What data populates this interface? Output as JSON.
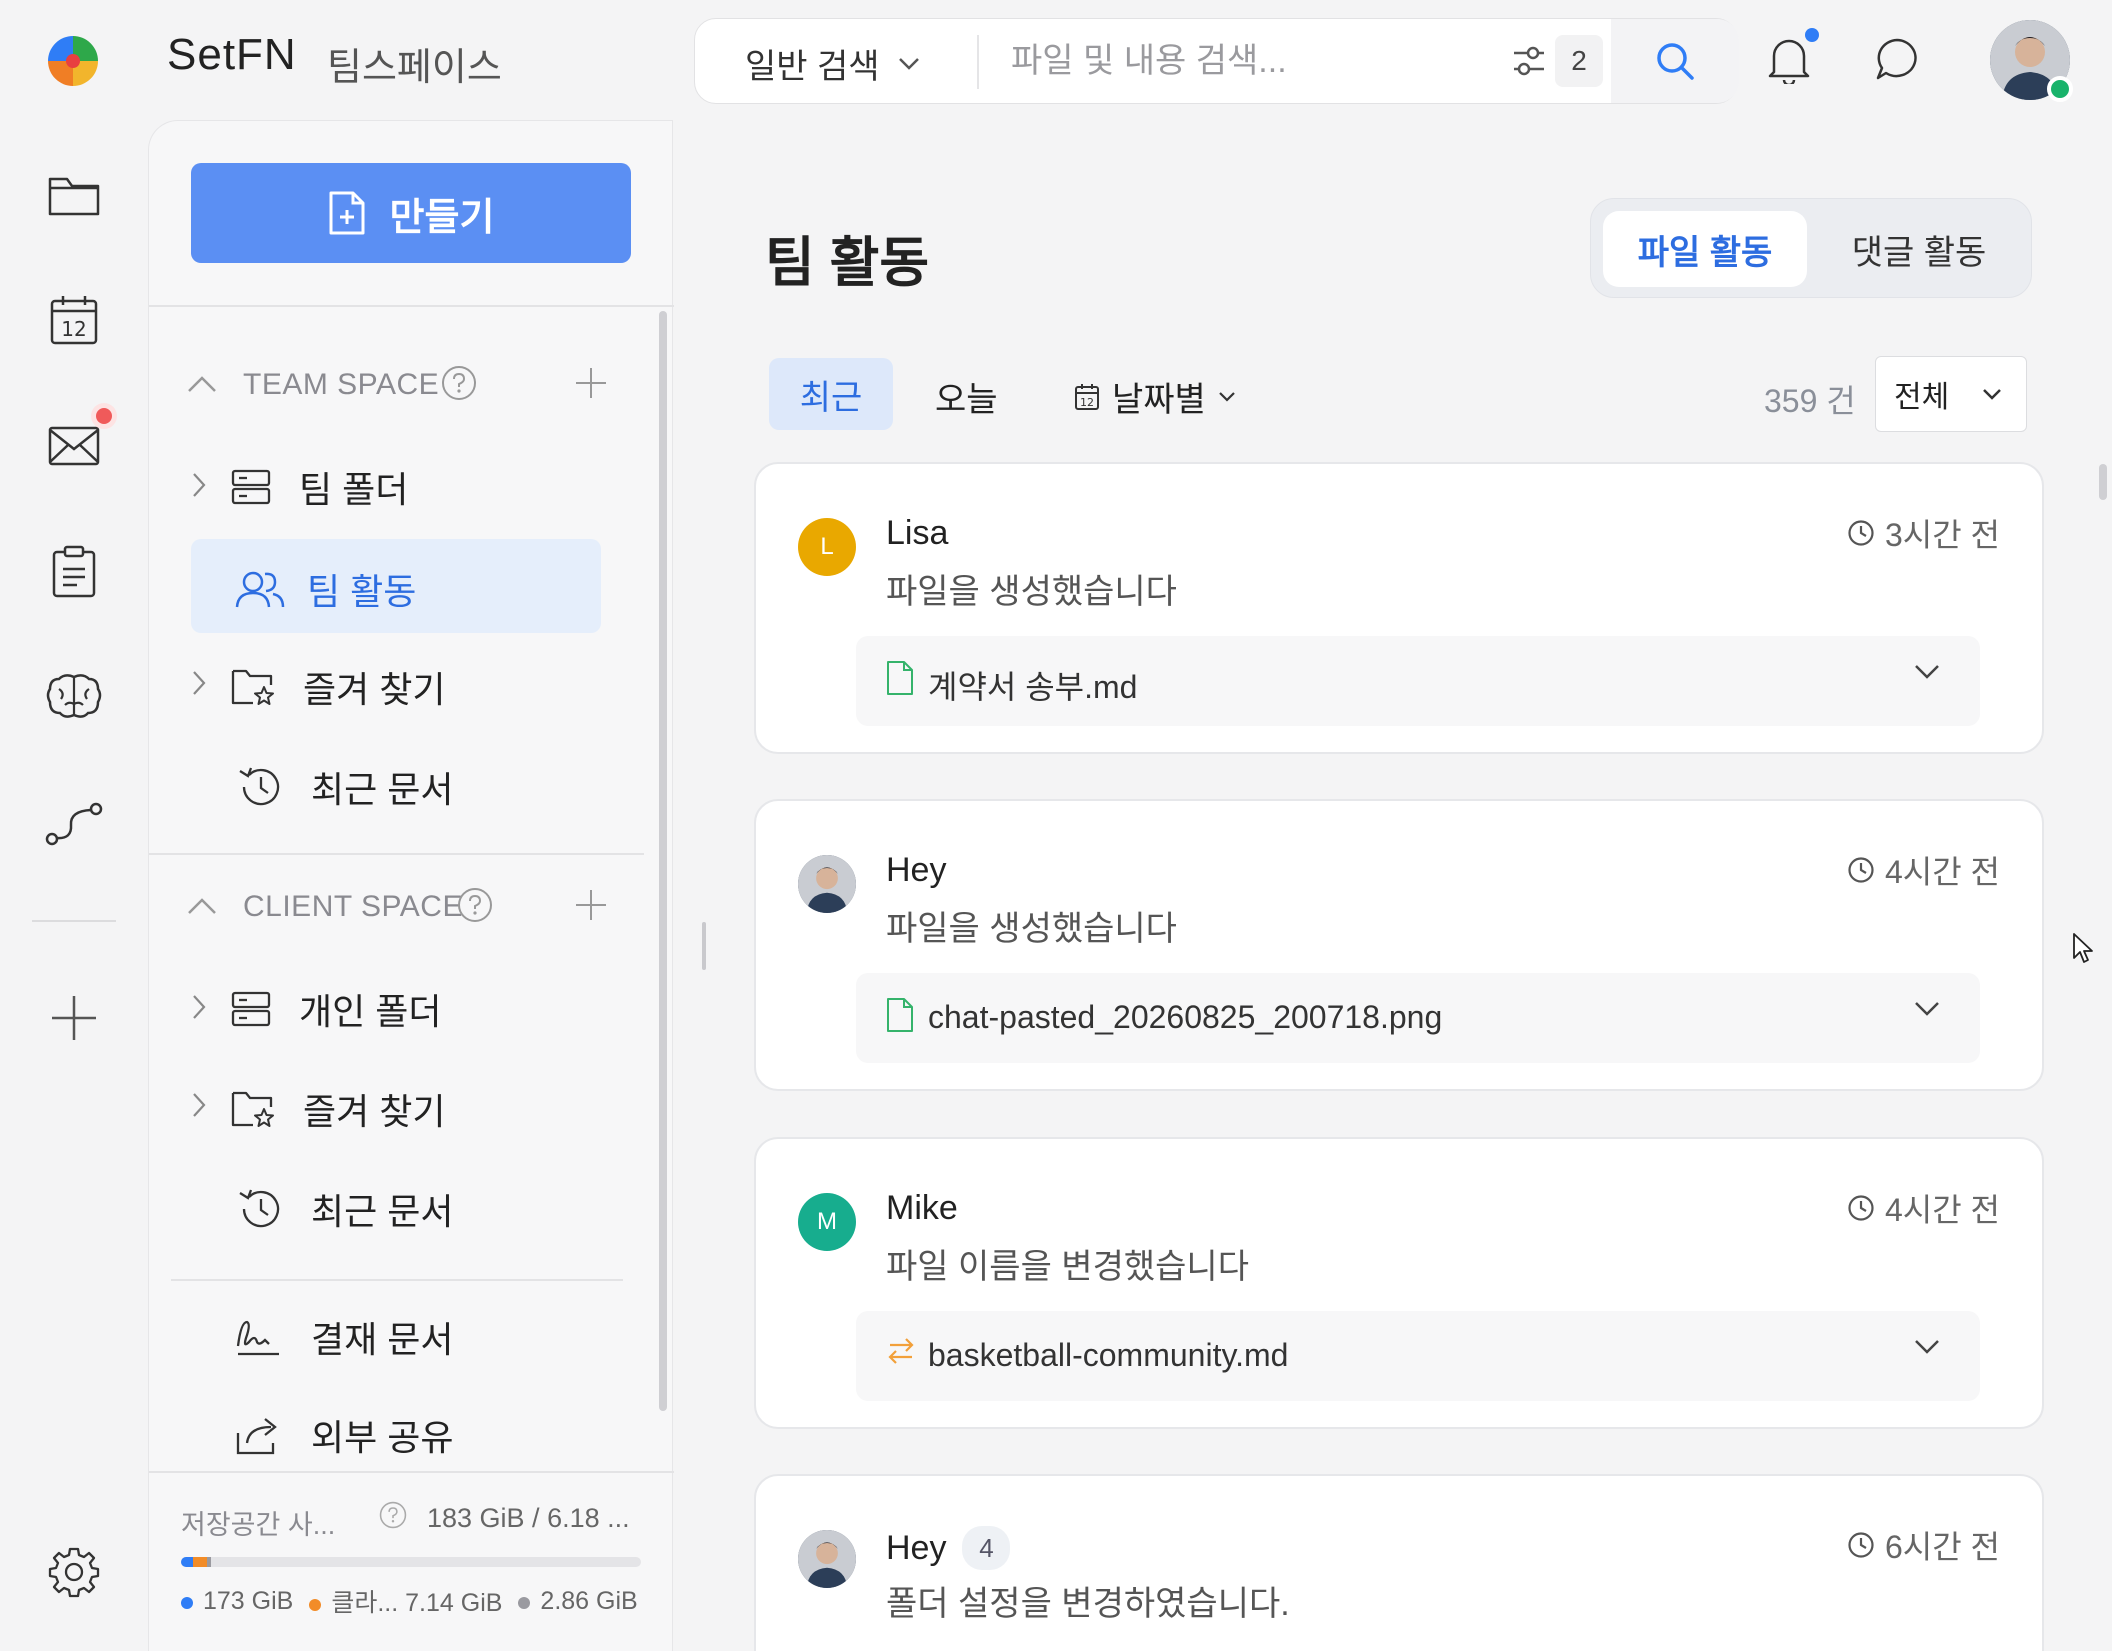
{
  "header": {
    "brand": "SetFN",
    "workspace": "팀스페이스",
    "search_type": "일반 검색",
    "search_placeholder": "파일 및 내용 검색...",
    "filter_count": "2"
  },
  "rail": {
    "items": [
      "folder-icon",
      "calendar-icon",
      "mail-icon",
      "clipboard-icon",
      "brain-icon",
      "route-icon"
    ],
    "calendar_day": "12"
  },
  "sidebar": {
    "create_label": "만들기",
    "team_space": {
      "title": "TEAM SPACE",
      "items": [
        {
          "label": "팀 폴더"
        },
        {
          "label": "팀 활동"
        },
        {
          "label": "즐겨 찾기"
        },
        {
          "label": "최근 문서"
        }
      ]
    },
    "client_space": {
      "title": "CLIENT SPACE",
      "items": [
        {
          "label": "개인 폴더"
        },
        {
          "label": "즐겨 찾기"
        },
        {
          "label": "최근 문서"
        }
      ]
    },
    "extra": [
      {
        "label": "결재 문서"
      },
      {
        "label": "외부 공유"
      }
    ],
    "storage": {
      "label": "저장공간 사...",
      "value": "183 GiB / 6.18 ...",
      "used_a": "173 GiB",
      "used_b_label": "클라...",
      "used_b": "7.14 GiB",
      "used_c": "2.86 GiB",
      "colors": {
        "a": "#2f7df6",
        "b": "#f28c28",
        "c": "#9a9aa0"
      }
    }
  },
  "main": {
    "title": "팀 활동",
    "segments": {
      "active": "파일 활동",
      "other": "댓글 활동"
    },
    "filters": {
      "recent": "최근",
      "today": "오늘",
      "by_date": "날짜별",
      "date_day": "12"
    },
    "count": "359 건",
    "scope": "전체",
    "cards": [
      {
        "name": "Lisa",
        "initial": "L",
        "avatar_color": "#e9a800",
        "action": "파일을 생성했습니다",
        "time": "3시간 전",
        "file": "계약서 송부.md",
        "icon": "file-icon"
      },
      {
        "name": "Hey",
        "initial": "",
        "avatar_color": "#3b4a5c",
        "action": "파일을 생성했습니다",
        "time": "4시간 전",
        "file": "chat-pasted_20260825_200718.png",
        "icon": "file-icon"
      },
      {
        "name": "Mike",
        "initial": "M",
        "avatar_color": "#17ad8e",
        "action": "파일 이름을 변경했습니다",
        "time": "4시간 전",
        "file": "basketball-community.md",
        "icon": "rename-icon"
      },
      {
        "name": "Hey",
        "initial": "",
        "avatar_color": "#3b4a5c",
        "badge": "4",
        "action": "폴더 설정을 변경하였습니다.",
        "time": "6시간 전"
      }
    ]
  }
}
